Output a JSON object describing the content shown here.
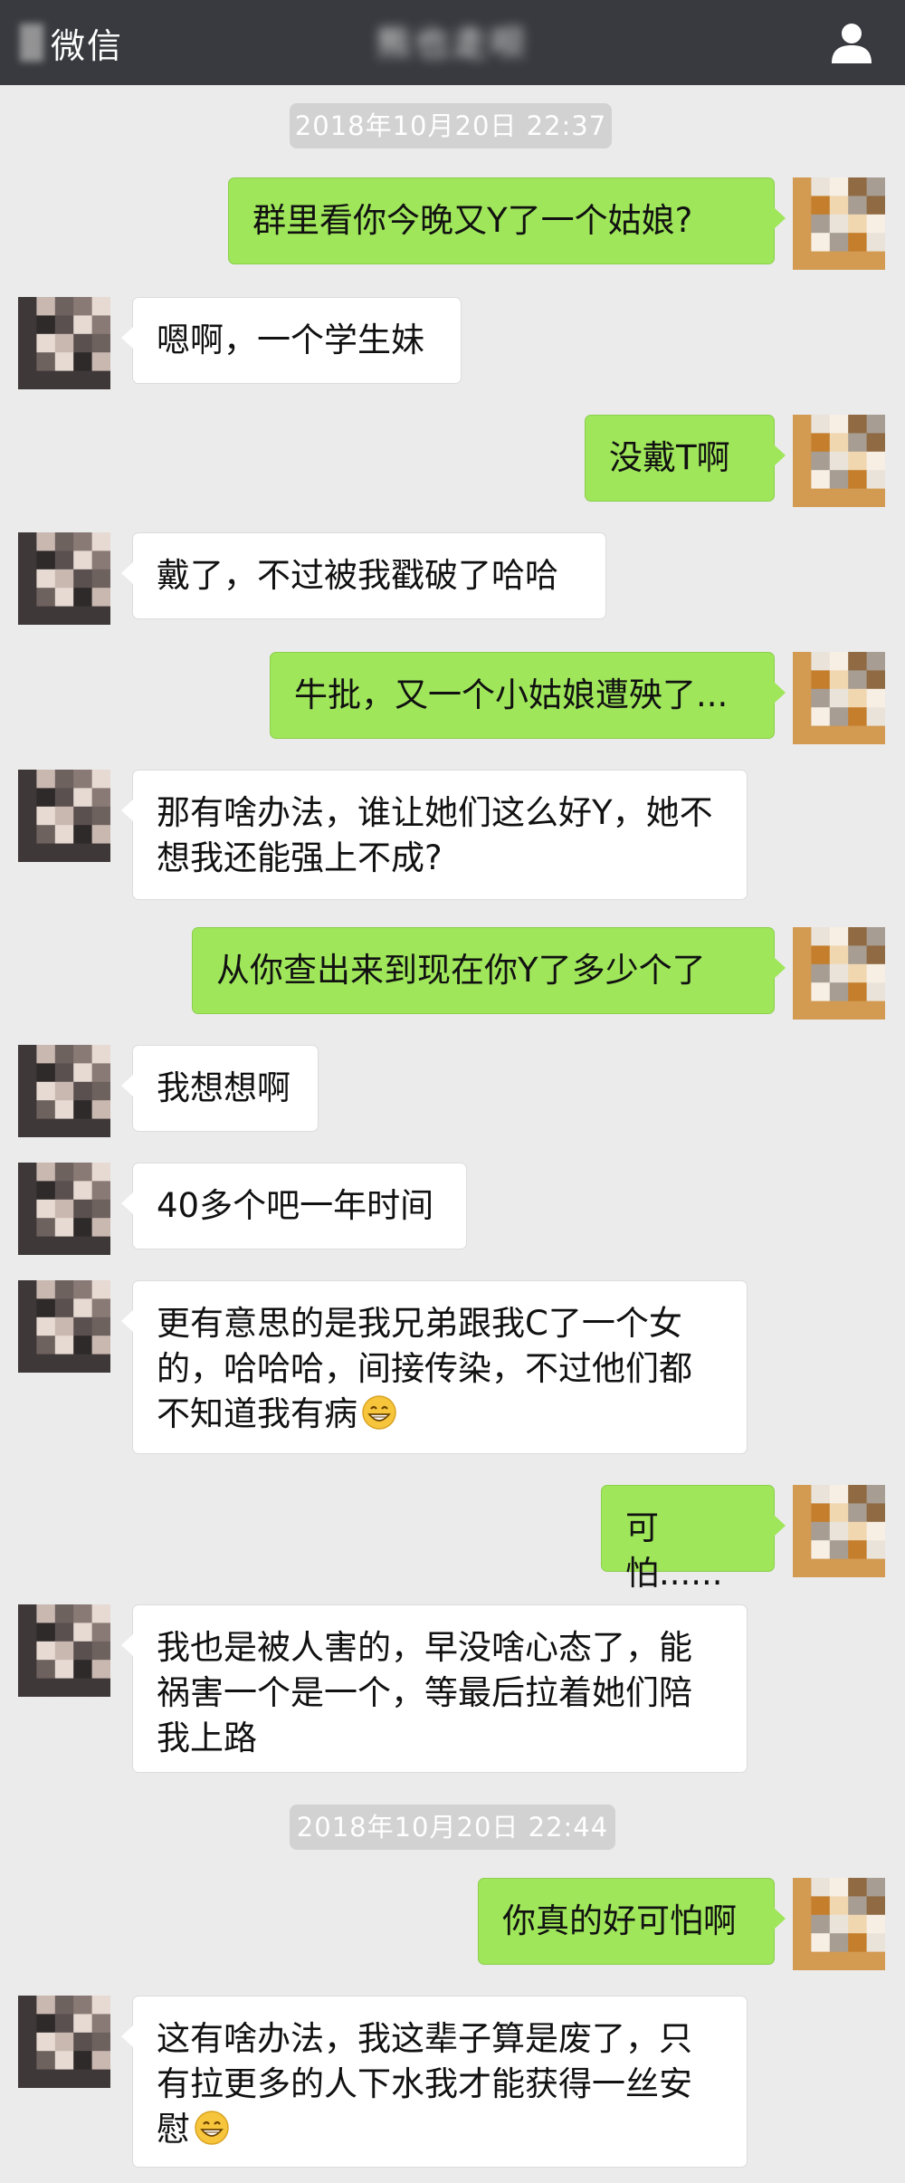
{
  "header": {
    "back_label": "微信",
    "title": "熊也走呗"
  },
  "colors": {
    "topbar": "#393a3f",
    "background": "#ebebeb",
    "sent_bubble": "#9fe65a",
    "received_bubble": "#ffffff",
    "timestamp_bg": "#d2d2d2"
  },
  "timestamps": [
    "2018年10月20日 22:37",
    "2018年10月20日 22:44"
  ],
  "messages": [
    {
      "side": "right",
      "text": "群里看你今晚又Y了一个姑娘?"
    },
    {
      "side": "left",
      "text": "嗯啊，一个学生妹"
    },
    {
      "side": "right",
      "text": "没戴T啊"
    },
    {
      "side": "left",
      "text": "戴了，不过被我戳破了哈哈"
    },
    {
      "side": "right",
      "text": "牛批，又一个小姑娘遭殃了..."
    },
    {
      "side": "left",
      "text": "那有啥办法，谁让她们这么好Y，她不想我还能强上不成?"
    },
    {
      "side": "right",
      "text": "从你查出来到现在你Y了多少个了"
    },
    {
      "side": "left",
      "text": "我想想啊"
    },
    {
      "side": "left",
      "text": "40多个吧一年时间"
    },
    {
      "side": "left",
      "text": "更有意思的是我兄弟跟我C了一个女的，哈哈哈，间接传染，不过他们都不知道我有病",
      "emoji": "grin-emoji"
    },
    {
      "side": "right",
      "text": "可怕......"
    },
    {
      "side": "left",
      "text": "我也是被人害的，早没啥心态了，能祸害一个是一个，等最后拉着她们陪我上路"
    },
    {
      "side": "right",
      "text": "你真的好可怕啊"
    },
    {
      "side": "left",
      "text": "这有啥办法，我这辈子算是废了，只有拉更多的人下水我才能获得一丝安慰",
      "emoji": "grin-emoji"
    }
  ]
}
